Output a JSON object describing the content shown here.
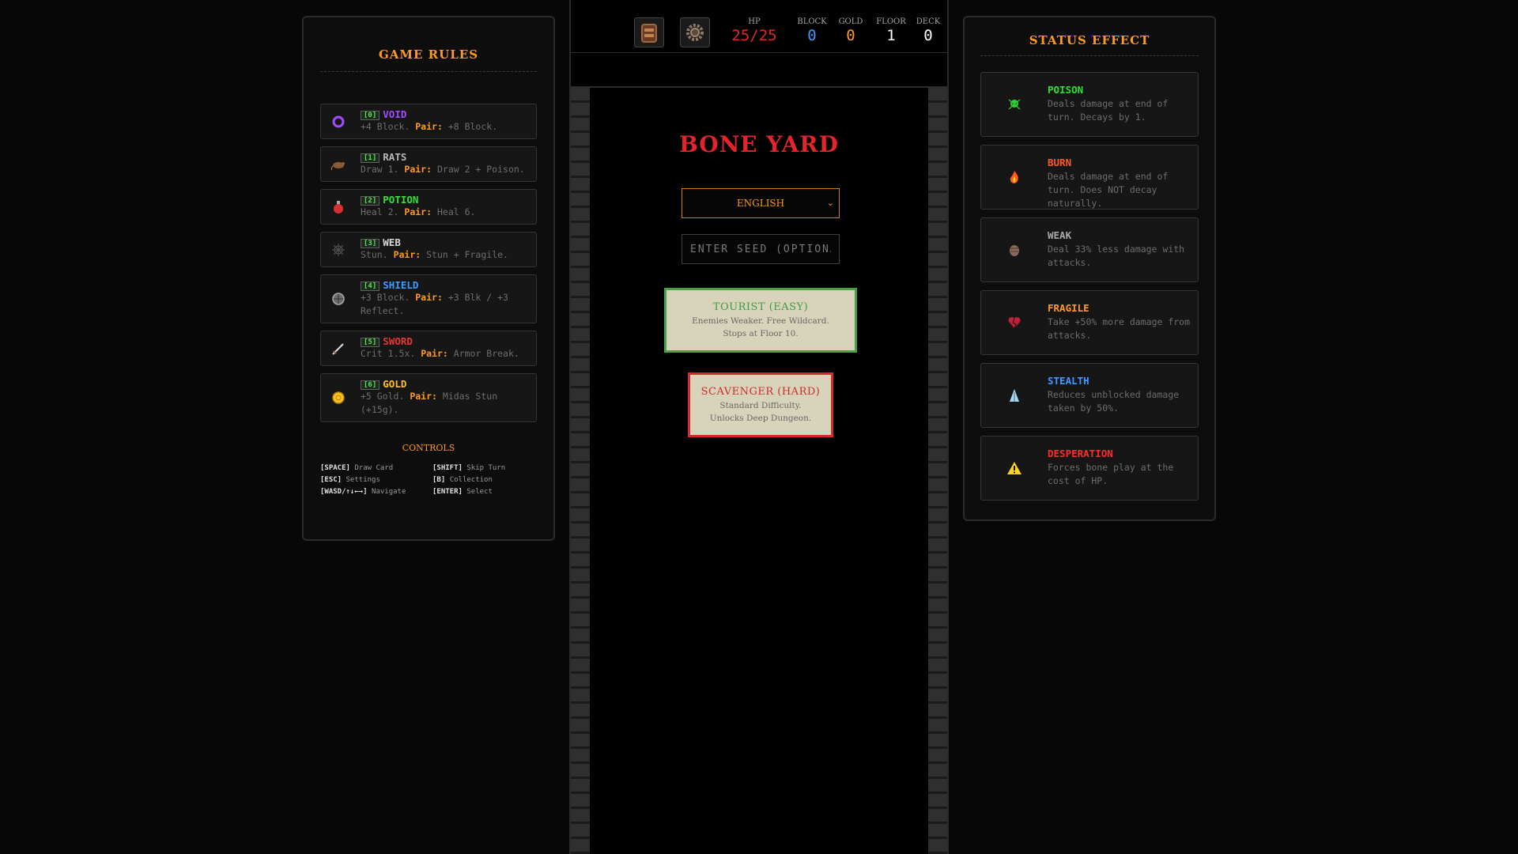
{
  "rules_panel": {
    "title": "GAME RULES",
    "items": [
      {
        "index": "[0]",
        "name": "VOID",
        "color": "#a24dff",
        "icon": "void-ring-icon",
        "desc": "+4 Block.",
        "pair_label": "Pair:",
        "pair": "+8 Block."
      },
      {
        "index": "[1]",
        "name": "RATS",
        "color": "#b8b8b8",
        "icon": "rat-icon",
        "desc": "Draw 1.",
        "pair_label": "Pair:",
        "pair": "Draw 2 + Poison."
      },
      {
        "index": "[2]",
        "name": "POTION",
        "color": "#37e037",
        "icon": "potion-icon",
        "desc": "Heal 2.",
        "pair_label": "Pair:",
        "pair": "Heal 6."
      },
      {
        "index": "[3]",
        "name": "WEB",
        "color": "#d8d8d8",
        "icon": "web-icon",
        "desc": "Stun.",
        "pair_label": "Pair:",
        "pair": "Stun + Fragile."
      },
      {
        "index": "[4]",
        "name": "SHIELD",
        "color": "#3d9bff",
        "icon": "shield-icon",
        "desc": "+3 Block.",
        "pair_label": "Pair:",
        "pair": "+3 Blk / +3 Reflect."
      },
      {
        "index": "[5]",
        "name": "SWORD",
        "color": "#e83535",
        "icon": "sword-icon",
        "desc": "Crit 1.5x.",
        "pair_label": "Pair:",
        "pair": "Armor Break."
      },
      {
        "index": "[6]",
        "name": "GOLD",
        "color": "#ffc21f",
        "icon": "gold-coin-icon",
        "desc": "+5 Gold.",
        "pair_label": "Pair:",
        "pair": "Midas Stun (+15g)."
      }
    ],
    "controls_title": "CONTROLS",
    "controls": [
      {
        "key": "[SPACE]",
        "action": "Draw Card"
      },
      {
        "key": "[SHIFT]",
        "action": "Skip Turn"
      },
      {
        "key": "[ESC]",
        "action": "Settings"
      },
      {
        "key": "[B]",
        "action": "Collection"
      },
      {
        "key": "[WASD/↑↓←→]",
        "action": "Navigate"
      },
      {
        "key": "[ENTER]",
        "action": "Select"
      }
    ]
  },
  "status_panel": {
    "title": "STATUS EFFECT",
    "items": [
      {
        "name": "POISON",
        "color": "#2fe02f",
        "icon": "poison-skull-icon",
        "desc": "Deals damage at end of turn. Decays by 1."
      },
      {
        "name": "BURN",
        "color": "#ff5a1f",
        "icon": "flame-icon",
        "desc": "Deals damage at end of turn. Does NOT decay naturally."
      },
      {
        "name": "WEAK",
        "color": "#a8a8a8",
        "icon": "weak-fist-icon",
        "desc": "Deal 33% less damage with attacks."
      },
      {
        "name": "FRAGILE",
        "color": "#ff9a1f",
        "icon": "broken-heart-icon",
        "desc": "Take +50% more damage from attacks."
      },
      {
        "name": "STEALTH",
        "color": "#3d9bff",
        "icon": "cloak-icon",
        "desc": "Reduces unblocked damage taken by 50%."
      },
      {
        "name": "DESPERATION",
        "color": "#ff2a2a",
        "icon": "warning-icon",
        "desc": "Forces bone play at the cost of HP."
      }
    ]
  },
  "hud": {
    "buttons": [
      {
        "name": "bag-button",
        "icon": "bag-icon"
      },
      {
        "name": "settings-button",
        "icon": "gear-icon"
      }
    ],
    "stats": [
      {
        "label": "HP",
        "value": "25/25",
        "color": "#e3242b"
      },
      {
        "label": "BLOCK",
        "value": "0",
        "color": "#3d9bff"
      },
      {
        "label": "GOLD",
        "value": "0",
        "color": "#ff9a1f"
      },
      {
        "label": "FLOOR",
        "value": "1",
        "color": "#ffffff"
      },
      {
        "label": "DECK",
        "value": "0",
        "color": "#ffffff"
      }
    ]
  },
  "main": {
    "title": "BONE YARD",
    "language": "ENGLISH",
    "seed_placeholder": "ENTER SEED (OPTIONAL)",
    "modes": [
      {
        "title": "TOURIST (EASY)",
        "line1": "Enemies Weaker. Free Wildcard.",
        "line2": "Stops at Floor 10."
      },
      {
        "title": "SCAVENGER (HARD)",
        "line1": "Standard Difficulty.",
        "line2": "Unlocks Deep Dungeon."
      }
    ]
  }
}
